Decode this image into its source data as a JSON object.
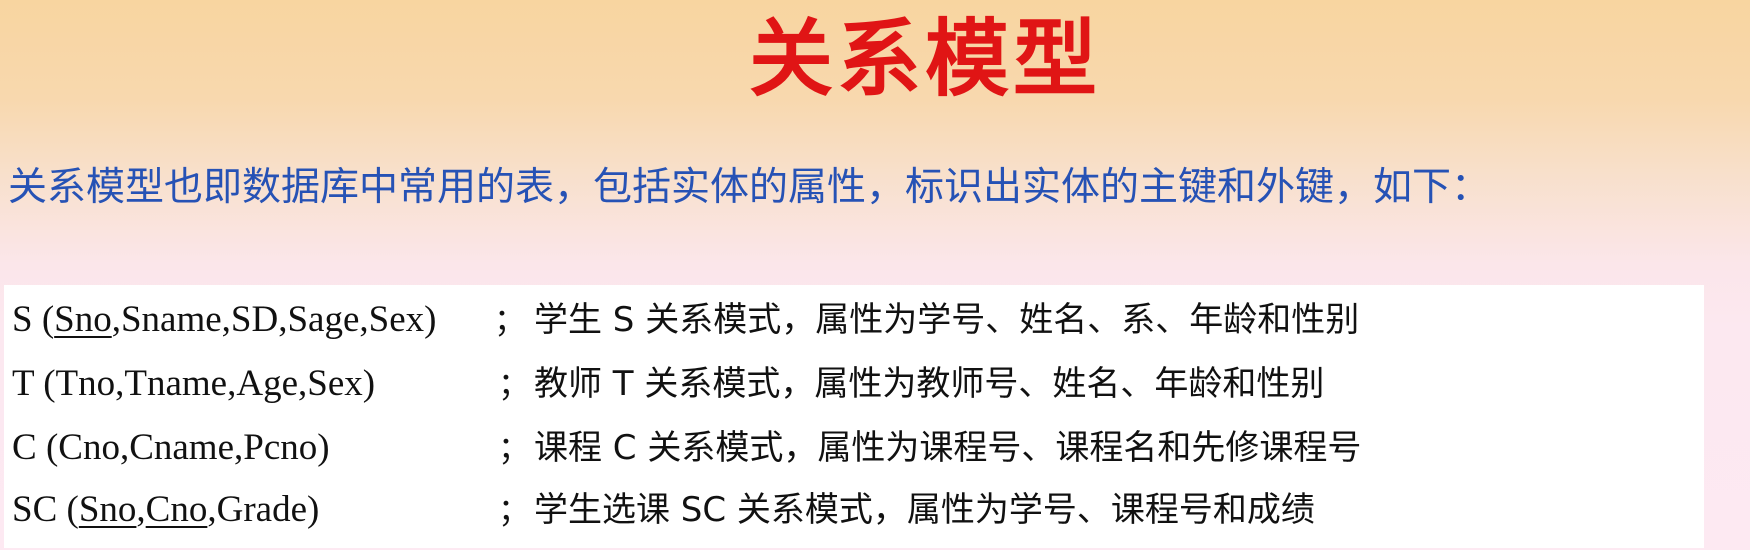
{
  "title": "关系模型",
  "intro": "关系模型也即数据库中常用的表，包括实体的属性，标识出实体的主键和外键，如下：",
  "separator": "；",
  "relations": [
    {
      "name": "S",
      "open": " (",
      "key1": "Sno",
      "mid": "",
      "key2": "",
      "rest": ",Sname,SD,Sage,Sex)",
      "description": "学生 S 关系模式，属性为学号、姓名、系、年龄和性别"
    },
    {
      "name": "T",
      "open": " (",
      "key1": "",
      "mid": "",
      "key2": "",
      "rest": "Tno,Tname,Age,Sex)",
      "description": "教师 T 关系模式，属性为教师号、姓名、年龄和性别"
    },
    {
      "name": "C",
      "open": " (",
      "key1": "",
      "mid": "",
      "key2": "",
      "rest": "Cno,Cname,Pcno)",
      "description": "课程 C 关系模式，属性为课程号、课程名和先修课程号"
    },
    {
      "name": "SC",
      "open": " (",
      "key1": "Sno",
      "mid": ",",
      "key2": "Cno",
      "rest": ",Grade)",
      "description": "学生选课 SC 关系模式，属性为学号、课程号和成绩"
    }
  ]
}
